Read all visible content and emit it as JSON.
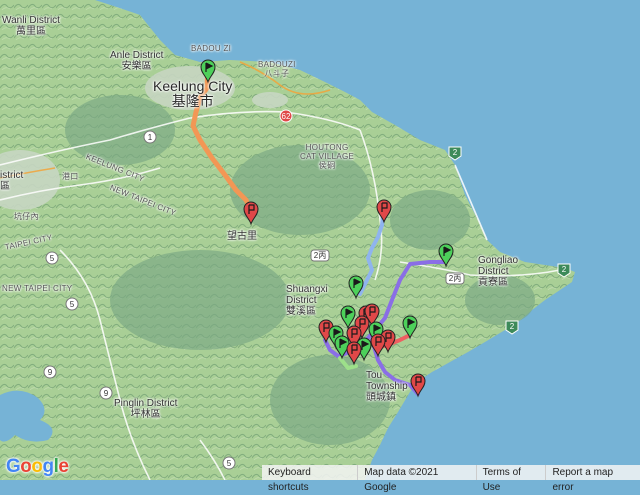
{
  "colors": {
    "sea": "#76b3d6",
    "land": "#a9cf96",
    "mountain": "#6f9f79",
    "route_orange": "#f29755",
    "route_purple": "#8a6ee6",
    "route_blue": "#8fb4ee",
    "route_red": "#ee5f61",
    "route_green": "#9de08a",
    "marker_green": "#4dd05a",
    "marker_red": "#e04848",
    "freeway": "#f2a33a"
  },
  "labels": {
    "wanli_en": "Wanli District",
    "wanli_zh": "萬里區",
    "anle_en": "Anle District",
    "anle_zh": "安樂區",
    "badouzi_1": "BADOU ZI",
    "badouzi_2": "BADOUZI",
    "badouzi_zh": "八斗子",
    "keelung_en": "Keelung City",
    "keelung_zh": "基隆市",
    "keelung_city": "KEELUNG CITY",
    "new_taipei_city": "NEW TAIPEI CITY",
    "taipei_city": "TAIPEI CITY",
    "houtong_1": "HOUTONG",
    "houtong_2": "CAT VILLAGE",
    "houtong_zh": "侯硐",
    "wanggu": "望古里",
    "shuangxi_1": "Shuangxi",
    "shuangxi_2": "District",
    "shuangxi_zh": "雙溪區",
    "gongliao_1": "Gongliao",
    "gongliao_2": "District",
    "gongliao_zh": "貢寮區",
    "toucheng_1": "Tou",
    "toucheng_2": "Township",
    "toucheng_zh": "頭城鎮",
    "pinglin_en": "Pinglin District",
    "pinglin_zh": "坪林區",
    "gangkou": "港口",
    "kengzinei": "坑仔內",
    "shih_district": "istrict",
    "shih_zh": "區"
  },
  "shields": {
    "r62": "62",
    "r2_a": "2",
    "r2_b": "2",
    "r2_c": "2",
    "r1": "1",
    "r5_a": "5",
    "r5_b": "5",
    "r5_c": "5",
    "r9_a": "9",
    "r9_b": "9",
    "r2bing_a": "2丙",
    "r2bing_b": "2丙"
  },
  "footer": {
    "shortcuts": "Keyboard shortcuts",
    "map_data": "Map data ©2021 Google",
    "terms": "Terms of Use",
    "report": "Report a map error"
  },
  "logo": {
    "text": "Google",
    "letter_colors": [
      "#4285F4",
      "#EA4335",
      "#FBBC05",
      "#4285F4",
      "#34A853",
      "#EA4335"
    ]
  }
}
